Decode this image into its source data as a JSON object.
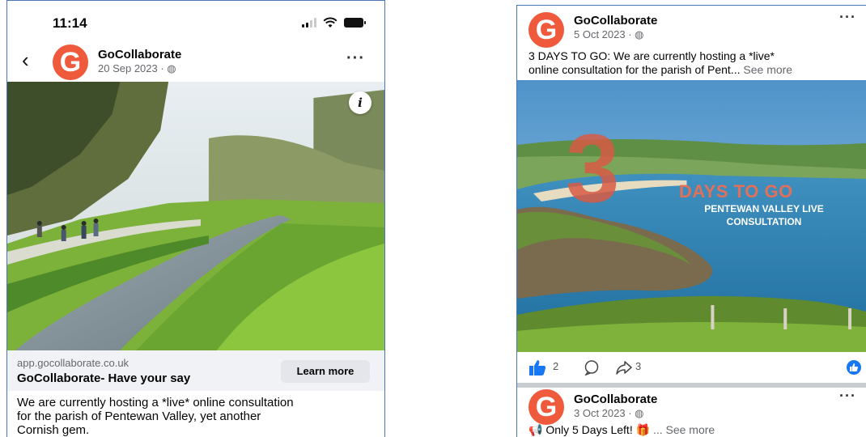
{
  "left_post": {
    "status_time": "11:14",
    "page_name": "GoCollaborate",
    "date": "20 Sep 2023 · ",
    "link_url": "app.gocollaborate.co.uk",
    "link_title": "GoCollaborate- Have your say",
    "cta_label": "Learn more",
    "body_lines": [
      "We are currently hosting a *live* online consultation",
      "for the parish of Pentewan Valley, yet another",
      "Cornish gem."
    ]
  },
  "right_post": {
    "page_name": "GoCollaborate",
    "date": "5 Oct 2023 · ",
    "text_line1": "3 DAYS TO GO: We are currently hosting a *live*",
    "text_line2": "online consultation for the parish of Pent...",
    "see_more": "See more",
    "image_text": {
      "big_number": "3",
      "headline": "DAYS TO GO",
      "line1": "PENTEWAN VALLEY LIVE",
      "line2": "CONSULTATION"
    },
    "like_count": "2",
    "share_count": "3"
  },
  "next_post": {
    "page_name": "GoCollaborate",
    "date": "3 Oct 2023 · ",
    "text": "Only 5 Days Left!",
    "see_more": "... See more"
  },
  "colors": {
    "brand_orange": "#ee5a3b",
    "facebook_blue": "#1877f2",
    "frame_blue": "#4a76b8"
  },
  "icons": [
    "back-chevron-icon",
    "globe-icon",
    "more-options-icon",
    "info-icon",
    "like-icon",
    "comment-icon",
    "share-icon",
    "megaphone-icon",
    "gift-icon"
  ]
}
